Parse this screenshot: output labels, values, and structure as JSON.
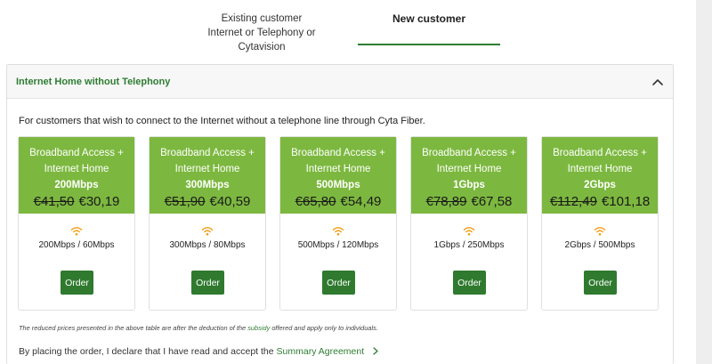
{
  "tabs": {
    "existing_line1": "Existing customer",
    "existing_line2": "Internet or Telephony or Cytavision",
    "new_label": "New customer"
  },
  "panel": {
    "title": "Internet Home without Telephony",
    "intro": "For customers that wish to connect to the Internet without a telephone line through Cyta Fiber."
  },
  "plans": [
    {
      "line1": "Broadband Access +",
      "line2": "Internet Home",
      "speed": "200Mbps",
      "old_price": "€41,50",
      "new_price": "€30,19",
      "speeds": "200Mbps / 60Mbps",
      "order": "Order"
    },
    {
      "line1": "Broadband Access +",
      "line2": "Internet Home",
      "speed": "300Mbps",
      "old_price": "€51,90",
      "new_price": "€40,59",
      "speeds": "300Mbps / 80Mbps",
      "order": "Order"
    },
    {
      "line1": "Broadband Access +",
      "line2": "Internet Home",
      "speed": "500Mbps",
      "old_price": "€65,80",
      "new_price": "€54,49",
      "speeds": "500Mbps / 120Mbps",
      "order": "Order"
    },
    {
      "line1": "Broadband Access +",
      "line2": "Internet Home",
      "speed": "1Gbps",
      "old_price": "€78,89",
      "new_price": "€67,58",
      "speeds": "1Gbps / 250Mbps",
      "order": "Order"
    },
    {
      "line1": "Broadband Access +",
      "line2": "Internet Home",
      "speed": "2Gbps",
      "old_price": "€112,49",
      "new_price": "€101,18",
      "speeds": "2Gbps / 500Mbps",
      "order": "Order"
    }
  ],
  "disclaimer": {
    "before": "The reduced prices presented in the above table are after the deduction of the ",
    "link": "subsidy",
    "after": " offered and apply only to individuals."
  },
  "declaration": {
    "text": "By placing the order, I declare that I have read and accept the ",
    "link": "Summary Agreement"
  },
  "colors": {
    "brand_green": "#2e7d32",
    "card_header_green": "#7cb83f",
    "order_button": "#2f7a2f",
    "wifi_icon": "#f39c12"
  },
  "icons": {
    "collapse": "chevron-up-icon",
    "signal": "wifi-icon",
    "link_arrow": "chevron-right-icon"
  }
}
